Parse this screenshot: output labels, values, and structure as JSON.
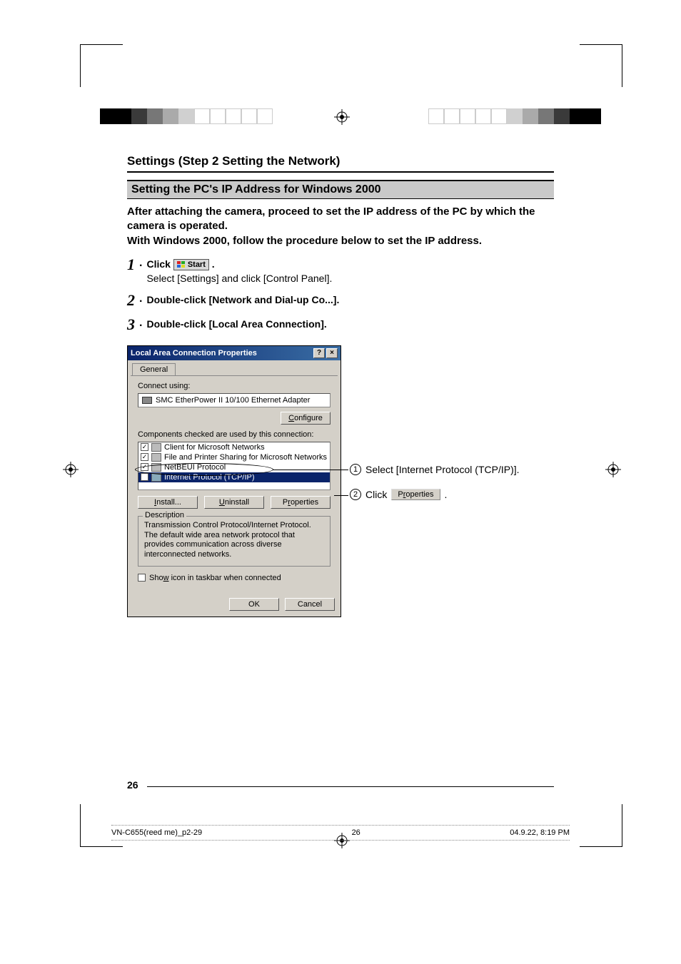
{
  "heading": "Settings (Step 2 Setting the Network)",
  "subheading": "Setting the PC's IP Address for Windows 2000",
  "intro_line1": "After attaching the camera, proceed to set the IP address of the PC by which the camera is operated.",
  "intro_line2": "With Windows 2000, follow the procedure below to set the IP address.",
  "steps": {
    "s1": {
      "num": "1",
      "main_pre": "Click ",
      "start": "Start",
      "main_post": ".",
      "sub": "Select [Settings] and click [Control Panel]."
    },
    "s2": {
      "num": "2",
      "main": "Double-click [Network and Dial-up Co...]."
    },
    "s3": {
      "num": "3",
      "main": "Double-click [Local Area Connection]."
    }
  },
  "dialog": {
    "title": "Local Area Connection Properties",
    "help_btn": "?",
    "close_btn": "×",
    "tab": "General",
    "connect_label": "Connect using:",
    "adapter": "SMC EtherPower II 10/100 Ethernet Adapter",
    "configure_btn": "Configure",
    "components_label": "Components checked are used by this connection:",
    "items": {
      "i0": "Client for Microsoft Networks",
      "i1": "File and Printer Sharing for Microsoft Networks",
      "i2": "NetBEUI Protocol",
      "i3": "Internet Protocol (TCP/IP)"
    },
    "install_btn": "Install...",
    "uninstall_btn": "Uninstall",
    "properties_btn": "Properties",
    "desc_title": "Description",
    "desc_text": "Transmission Control Protocol/Internet Protocol. The default wide area network protocol that provides communication across diverse interconnected networks.",
    "show_icon": "Show icon in taskbar when connected",
    "ok_btn": "OK",
    "cancel_btn": "Cancel"
  },
  "callouts": {
    "c1_num": "1",
    "c1_text": "Select [Internet Protocol (TCP/IP)].",
    "c2_num": "2",
    "c2_pre": "Click",
    "c2_btn": "Properties",
    "c2_post": "."
  },
  "page_number": "26",
  "footer": {
    "left": "VN-C655(reed me)_p2-29",
    "mid": "26",
    "right": "04.9.22, 8:19 PM"
  }
}
